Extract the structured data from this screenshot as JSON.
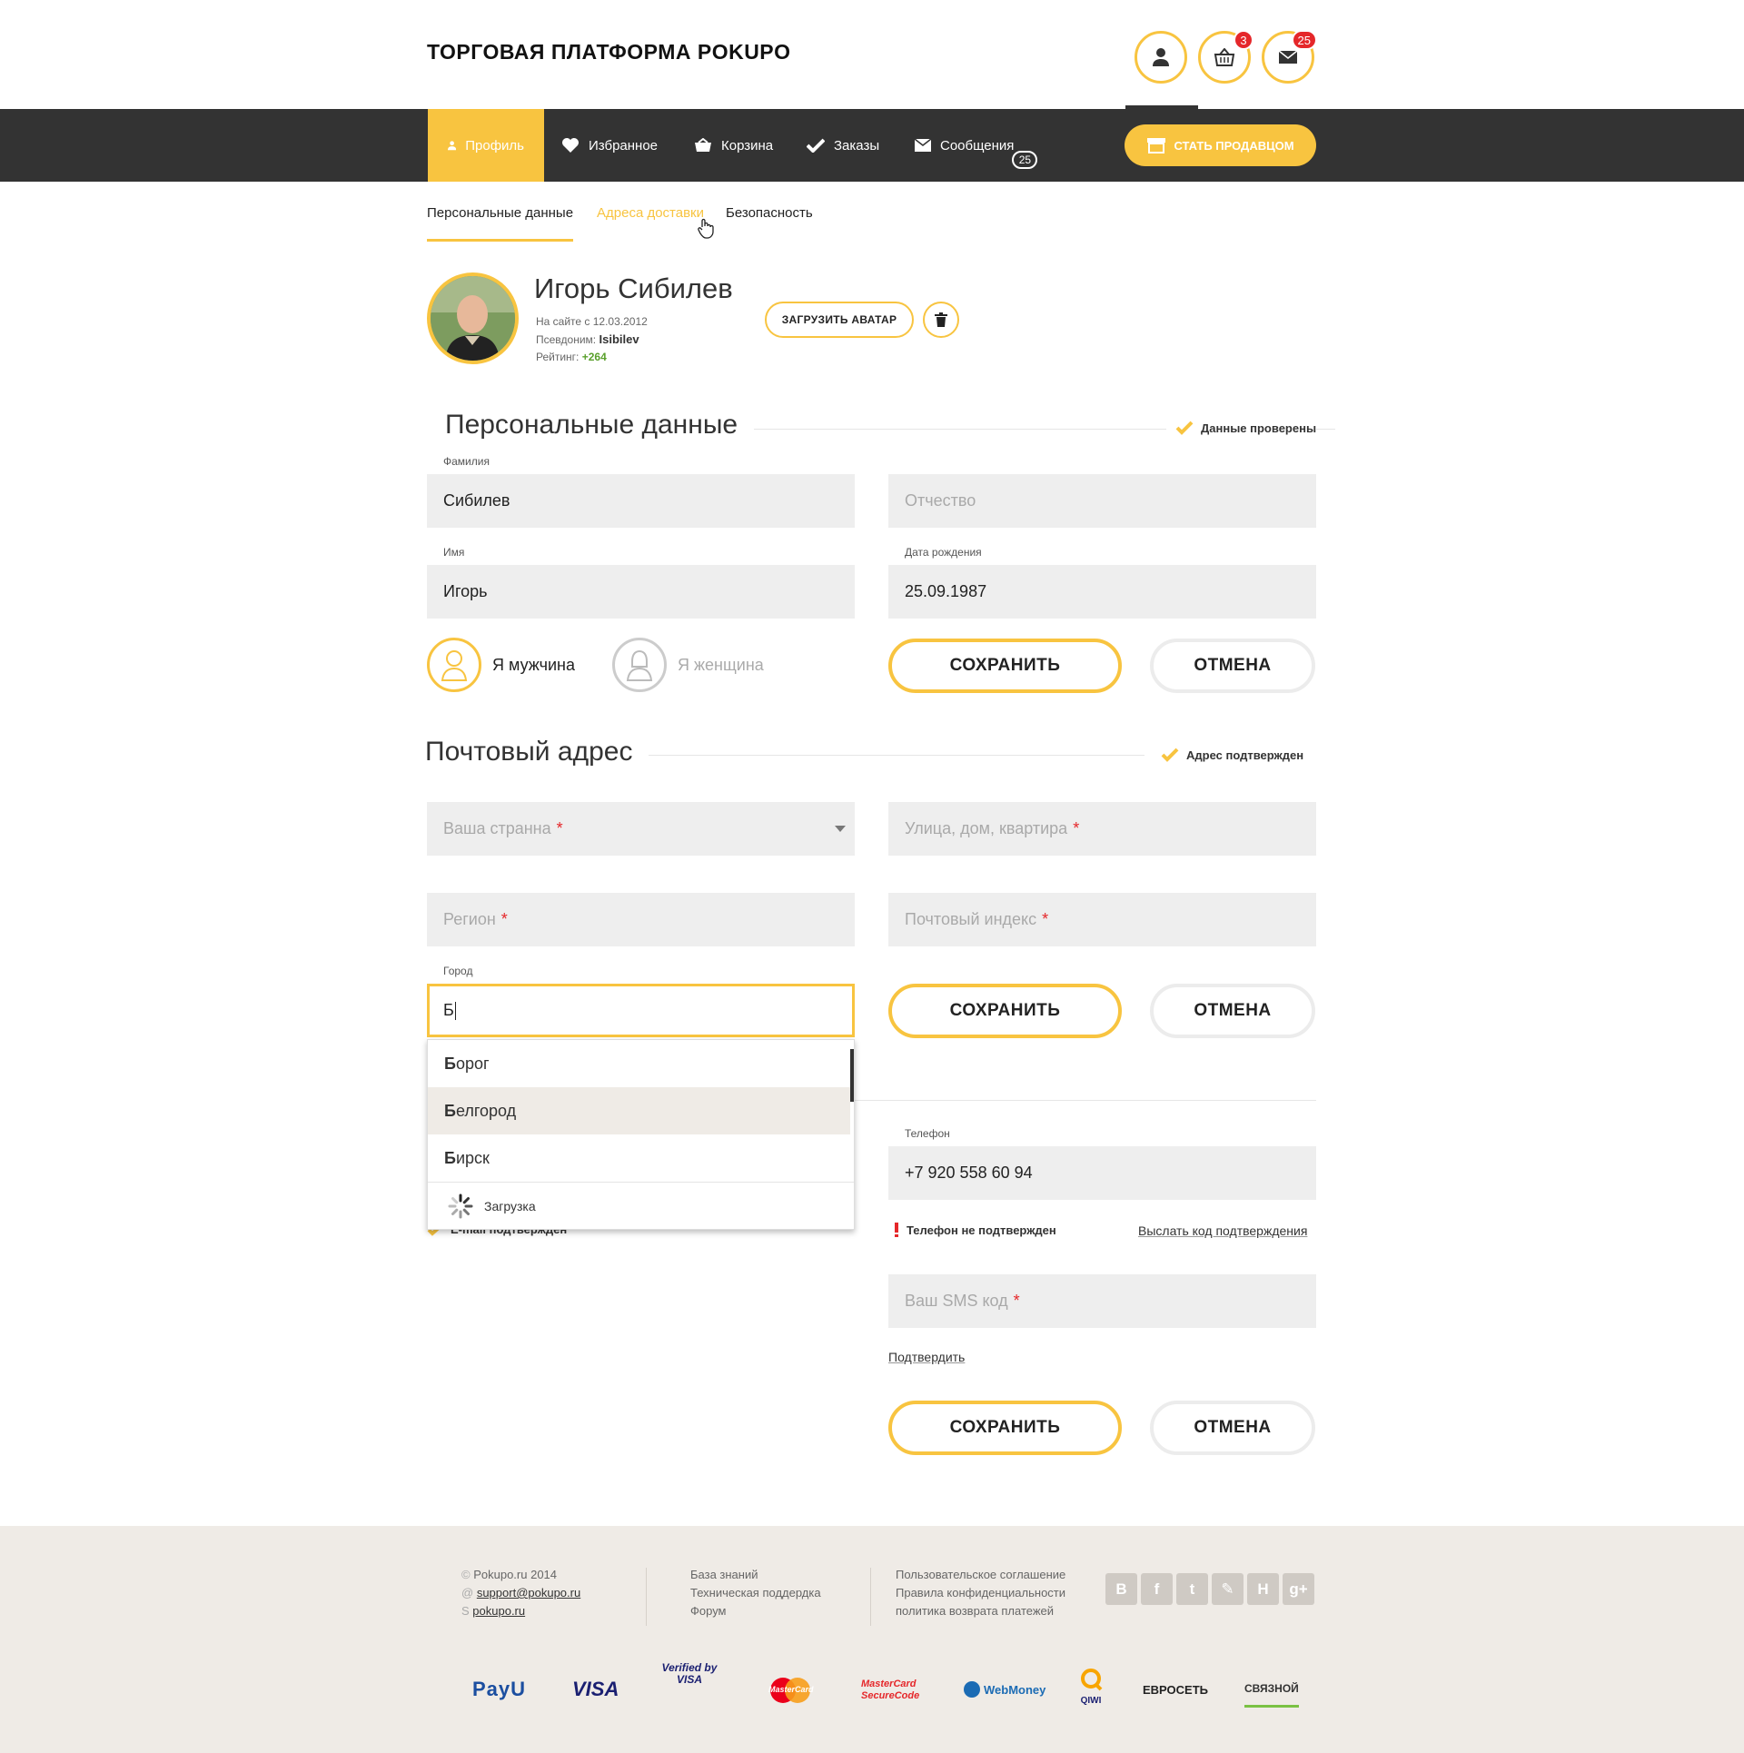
{
  "header": {
    "logo": "ТОРГОВАЯ ПЛАТФОРМА POKUPO",
    "cart_count": "3",
    "messages_count": "25"
  },
  "nav": {
    "items": [
      {
        "label": "Профиль"
      },
      {
        "label": "Избранное"
      },
      {
        "label": "Корзина"
      },
      {
        "label": "Заказы"
      },
      {
        "label": "Сообщения"
      }
    ],
    "messages_badge": "25",
    "seller_button": "СТАТЬ ПРОДАВЦОМ"
  },
  "subtabs": [
    "Персональные данные",
    "Адреса доставки",
    "Безопасность"
  ],
  "profile": {
    "name": "Игорь Сибилев",
    "since_label": "На сайте с 12.03.2012",
    "nick_label": "Псевдоним:",
    "nick": "Isibilev",
    "rating_label": "Рейтинг:",
    "rating": "+264",
    "upload_label": "ЗАГРУЗИТЬ АВАТАР"
  },
  "personal": {
    "title": "Персональные данные",
    "status": "Данные проверены",
    "surname_label": "Фамилия",
    "surname": "Сибилев",
    "patronymic_placeholder": "Отчество",
    "name_label": "Имя",
    "name": "Игорь",
    "birth_label": "Дата рождения",
    "birth": "25.09.1987",
    "male": "Я мужчина",
    "female": "Я женщина",
    "save": "СОХРАНИТЬ",
    "cancel": "ОТМЕНА"
  },
  "address": {
    "title": "Почтовый адрес",
    "status": "Адрес подтвержден",
    "country_placeholder": "Ваша странна",
    "street_placeholder": "Улица, дом, квартира",
    "region_placeholder": "Регион",
    "zip_placeholder": "Почтовый индекс",
    "city_label": "Город",
    "city_value": "Б",
    "save": "СОХРАНИТЬ",
    "cancel": "ОТМЕНА",
    "suggestions": [
      {
        "bold": "Б",
        "rest": "орог"
      },
      {
        "bold": "Б",
        "rest": "елгород"
      },
      {
        "bold": "Б",
        "rest": "ирск"
      }
    ],
    "loading": "Загрузка"
  },
  "contacts": {
    "email_status": "E-mail подтвержден",
    "phone_label": "Телефон",
    "phone": "+7 920 558 60 94",
    "phone_status": "Телефон не подтвержден",
    "send_code": "Выслать код подтверждения",
    "sms_placeholder": "Ваш SMS код",
    "confirm": "Подтвердить",
    "save": "СОХРАНИТЬ",
    "cancel": "ОТМЕНА"
  },
  "footer": {
    "copyright": "Pokupo.ru 2014",
    "email": "support@pokupo.ru",
    "skype": "pokupo.ru",
    "col2": [
      "База знаний",
      "Техническая поддердка",
      "Форум"
    ],
    "col3": [
      "Пользовательское соглашение",
      "Правила конфиденциальности",
      "политика возврата платежей"
    ],
    "social": [
      "vk-icon",
      "facebook-icon",
      "twitter-icon",
      "livejournal-icon",
      "habrahabr-icon",
      "googleplus-icon"
    ],
    "payments": [
      "PayU",
      "VISA",
      "Verified by VISA",
      "MasterCard",
      "MasterCard SecureCode",
      "WebMoney",
      "QIWI",
      "ЕВРОСЕТЬ",
      "СВЯЗНОЙ"
    ]
  },
  "colors": {
    "accent": "#f8c440",
    "nav_bg": "#333333",
    "badge": "#e5272a",
    "field_bg": "#eeeeee",
    "footer_bg": "#efebe6"
  }
}
